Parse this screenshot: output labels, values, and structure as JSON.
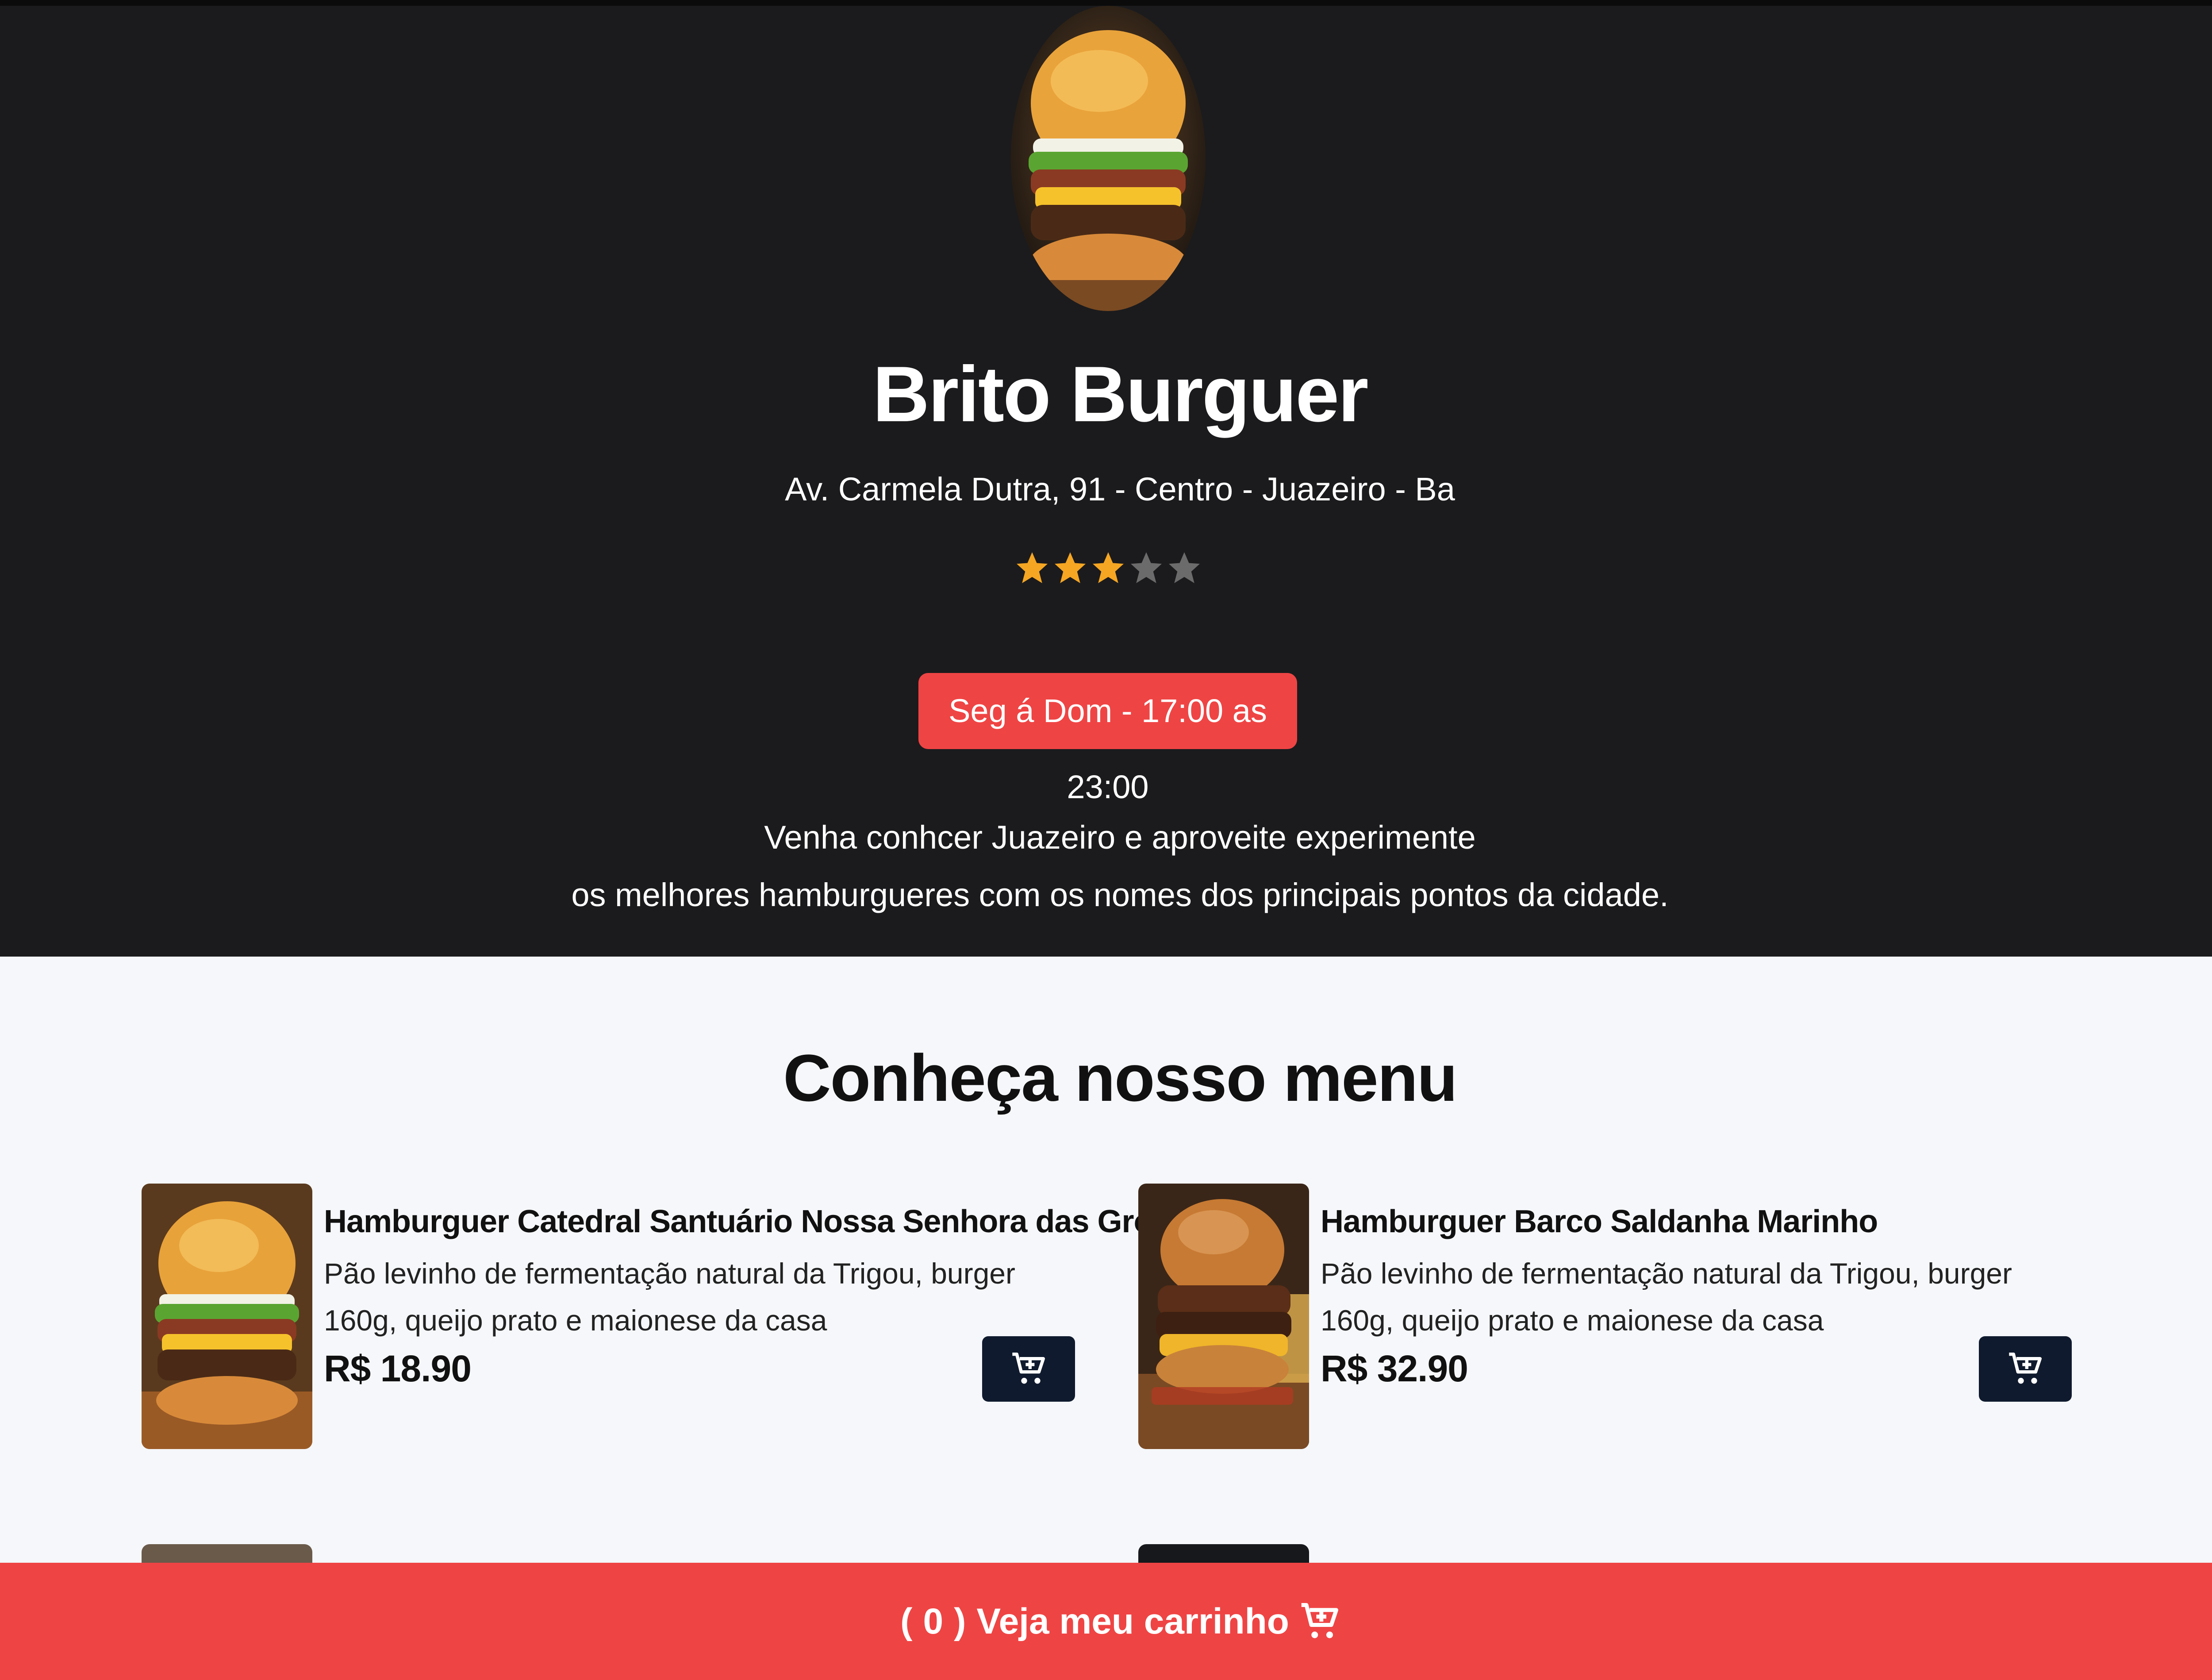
{
  "restaurant": {
    "name": "Brito Burguer",
    "address": "Av. Carmela Dutra, 91 - Centro - Juazeiro - Ba",
    "rating": {
      "value": 3,
      "max": 5
    },
    "hours": "Seg á Dom - 17:00 as 23:00",
    "description_line1": "Venha conhcer Juazeiro e aproveite experimente",
    "description_line2": "os melhores hamburgueres com os nomes dos principais pontos da cidade."
  },
  "menu": {
    "title": "Conheça nosso menu",
    "items": [
      {
        "name": "Hamburguer Catedral Santuário Nossa Senhora das Grotas",
        "description": "Pão levinho de fermentação natural da Trigou, burger 160g, queijo prato e maionese da casa",
        "price": "R$ 18.90",
        "image": "burger-photo"
      },
      {
        "name": "Hamburguer Barco Saldanha Marinho",
        "description": "Pão levinho de fermentação natural da Trigou, burger 160g, queijo prato e maionese da casa",
        "price": "R$ 32.90",
        "image": "burger-photo"
      }
    ]
  },
  "cart": {
    "count_open": "(",
    "count": "0",
    "count_close": ")",
    "label": "Veja meu carrinho",
    "icon": "cart-plus-icon"
  },
  "colors": {
    "hero_background": "#1b1b1d",
    "accent_red": "#ef4444",
    "cart_button": "#0f1a2e",
    "star_filled": "#f5a623",
    "star_empty": "#6b6b6b",
    "page_background": "#f5f7fa"
  }
}
